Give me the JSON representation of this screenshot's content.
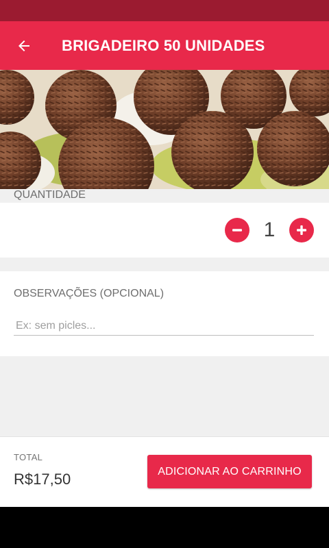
{
  "app_bar": {
    "title": "BRIGADEIRO 50 UNIDADES",
    "back_icon": "arrow-left-icon"
  },
  "hero": {
    "image_subject": "brigadeiros with chocolate sprinkles in paper cups"
  },
  "quantity": {
    "label": "QUANTIDADE",
    "value": "1",
    "decrement_icon": "minus-circle-icon",
    "increment_icon": "plus-circle-icon"
  },
  "notes": {
    "label": "OBSERVAÇÕES (OPCIONAL)",
    "placeholder": "Ex: sem picles...",
    "value": ""
  },
  "footer": {
    "total_label": "TOTAL",
    "total_value": "R$17,50",
    "add_button_label": "ADICIONAR AO CARRINHO"
  },
  "colors": {
    "status_bar": "#9b1b30",
    "primary": "#e8294a",
    "background": "#f0f0f0"
  }
}
